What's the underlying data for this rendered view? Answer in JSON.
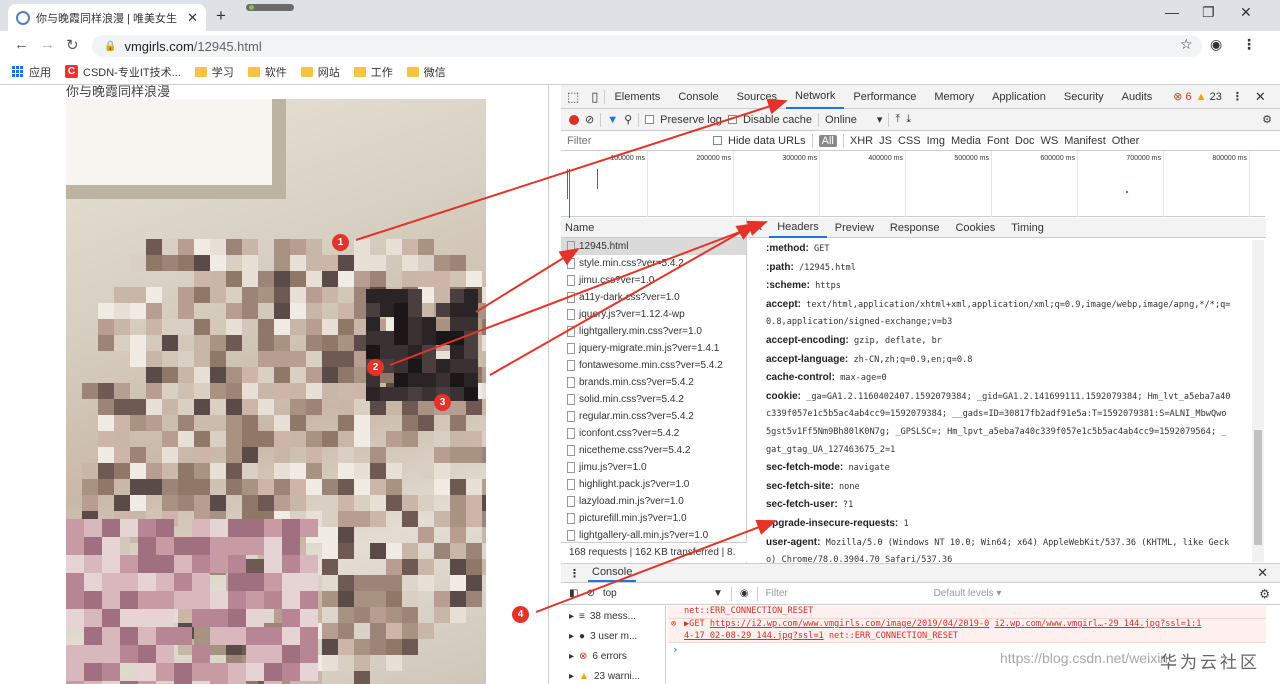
{
  "browser": {
    "tab_title": "你与晚霞同样浪漫 | 唯美女生",
    "url_host": "vmgirls.com",
    "url_path": "/12945.html",
    "bookmarks": [
      {
        "label": "应用",
        "icon": "apps-icon"
      },
      {
        "label": "CSDN-专业IT技术...",
        "icon": "csdn-icon"
      },
      {
        "label": "学习",
        "icon": "folder-icon"
      },
      {
        "label": "软件",
        "icon": "folder-icon"
      },
      {
        "label": "网站",
        "icon": "folder-icon"
      },
      {
        "label": "工作",
        "icon": "folder-icon"
      },
      {
        "label": "微信",
        "icon": "folder-icon"
      }
    ]
  },
  "page": {
    "title": "你与晚霞同样浪漫"
  },
  "devtools": {
    "tabs": [
      "Elements",
      "Console",
      "Sources",
      "Network",
      "Performance",
      "Memory",
      "Application",
      "Security",
      "Audits"
    ],
    "active_tab": "Network",
    "errors": "6",
    "warnings": "23",
    "toolbar": {
      "preserve_log": "Preserve log",
      "disable_cache": "Disable cache",
      "throttle": "Online"
    },
    "filter_placeholder": "Filter",
    "hide_data_urls": "Hide data URLs",
    "type_filters": [
      "All",
      "XHR",
      "JS",
      "CSS",
      "Img",
      "Media",
      "Font",
      "Doc",
      "WS",
      "Manifest",
      "Other"
    ],
    "timeline_ticks": [
      "100000 ms",
      "200000 ms",
      "300000 ms",
      "400000 ms",
      "500000 ms",
      "600000 ms",
      "700000 ms",
      "800000 ms"
    ],
    "name_header": "Name",
    "requests": [
      "12945.html",
      "style.min.css?ver=5.4.2",
      "jimu.css?ver=1.0",
      "a11y-dark.css?ver=1.0",
      "jquery.js?ver=1.12.4-wp",
      "lightgallery.min.css?ver=1.0",
      "jquery-migrate.min.js?ver=1.4.1",
      "fontawesome.min.css?ver=5.4.2",
      "brands.min.css?ver=5.4.2",
      "solid.min.css?ver=5.4.2",
      "regular.min.css?ver=5.4.2",
      "iconfont.css?ver=5.4.2",
      "nicetheme.css?ver=5.4.2",
      "jimu.js?ver=1.0",
      "highlight.pack.js?ver=1.0",
      "lazyload.min.js?ver=1.0",
      "picturefill.min.js?ver=1.0",
      "lightgallery-all.min.js?ver=1.0"
    ],
    "summary": "168 requests | 162 KB transferred | 8.",
    "detail_tabs": [
      "Headers",
      "Preview",
      "Response",
      "Cookies",
      "Timing"
    ],
    "headers": [
      {
        "k": ":method:",
        "v": "GET"
      },
      {
        "k": ":path:",
        "v": "/12945.html"
      },
      {
        "k": ":scheme:",
        "v": "https"
      },
      {
        "k": "accept:",
        "v": "text/html,application/xhtml+xml,application/xml;q=0.9,image/webp,image/apng,*/*;q="
      },
      {
        "k": "",
        "v": "0.8,application/signed-exchange;v=b3"
      },
      {
        "k": "accept-encoding:",
        "v": "gzip, deflate, br"
      },
      {
        "k": "accept-language:",
        "v": "zh-CN,zh;q=0.9,en;q=0.8"
      },
      {
        "k": "cache-control:",
        "v": "max-age=0"
      },
      {
        "k": "cookie:",
        "v": "_ga=GA1.2.1160402407.1592079384; _gid=GA1.2.141699111.1592079384; Hm_lvt_a5eba7a40"
      },
      {
        "k": "",
        "v": "c339f057e1c5b5ac4ab4cc9=1592079384; __gads=ID=30817fb2adf91e5a:T=1592079381:S=ALNI_MbwQwo"
      },
      {
        "k": "",
        "v": "5gst5v1Ff5Nm9Bh80lK0N7g; _GPSLSC=; Hm_lpvt_a5eba7a40c339f057e1c5b5ac4ab4cc9=1592079564; _"
      },
      {
        "k": "",
        "v": "gat_gtag_UA_127463675_2=1"
      },
      {
        "k": "sec-fetch-mode:",
        "v": "navigate"
      },
      {
        "k": "sec-fetch-site:",
        "v": "none"
      },
      {
        "k": "sec-fetch-user:",
        "v": "?1"
      },
      {
        "k": "upgrade-insecure-requests:",
        "v": "1"
      },
      {
        "k": "user-agent:",
        "v": "Mozilla/5.0 (Windows NT 10.0; Win64; x64) AppleWebKit/537.36 (KHTML, like Geck"
      },
      {
        "k": "",
        "v": "o) Chrome/78.0.3904.70 Safari/537.36"
      }
    ],
    "console": {
      "label": "Console",
      "context": "top",
      "filter": "Filter",
      "levels": "Default levels ▾",
      "sidebar": [
        {
          "icon": "list-icon",
          "text": "38 mess..."
        },
        {
          "icon": "user-icon",
          "text": "3 user m..."
        },
        {
          "icon": "error-icon",
          "text": "6 errors"
        },
        {
          "icon": "warning-icon",
          "text": "23 warni..."
        }
      ],
      "err1": "net::ERR_CONNECTION_RESET",
      "err2_prefix": "▶GET ",
      "err2_link1": "https://i2.wp.com/www.vmgirls.com/image/2019/04/2019-0",
      "err2_link2": "i2.wp.com/www.vmgirl…-29_144.jpg?ssl=1:1",
      "err2_link3": "4-17_02-08-29_144.jpg?ssl=1",
      "err2_suffix": " net::ERR_CONNECTION_RESET"
    }
  },
  "annotations": [
    "1",
    "2",
    "3",
    "4"
  ],
  "watermark": "https://blog.csdn.net/weixin_",
  "watermark2": "华为云社区"
}
